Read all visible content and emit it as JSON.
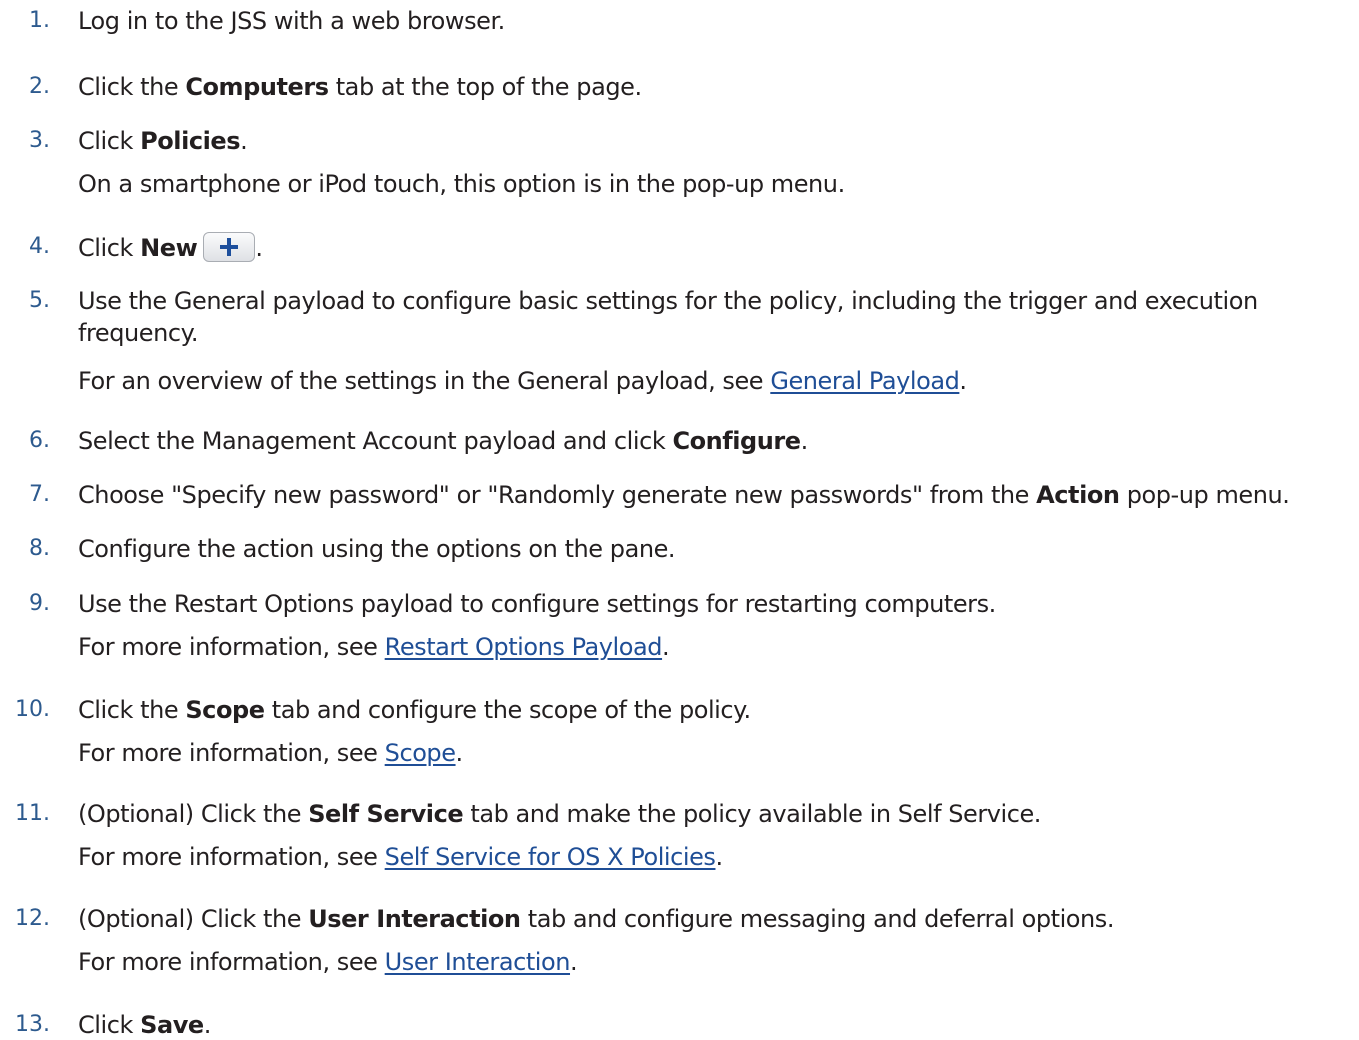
{
  "steps": [
    {
      "num": "1.",
      "a": "Log in to the JSS with a web browser."
    },
    {
      "num": "2.",
      "a": "Click the ",
      "b": "Computers",
      "c": " tab at the top of the page."
    },
    {
      "num": "3.",
      "a": "Click ",
      "b": "Policies",
      "c": ".",
      "note": "On a smartphone or iPod touch, this option is in the pop-up menu."
    },
    {
      "num": "4.",
      "a": "Click ",
      "b": "New",
      "c": ".",
      "button_icon": "plus-icon"
    },
    {
      "num": "5.",
      "a": "Use the General payload to configure basic settings for the policy, including the trigger and execution",
      "a2": "frequency.",
      "note": "For an overview of the settings in the General payload, see ",
      "link": "General Payload",
      "after": "."
    },
    {
      "num": "6.",
      "a": "Select the Management Account payload and click ",
      "b": "Configure",
      "c": "."
    },
    {
      "num": "7.",
      "a": "Choose \"Specify new password\" or \"Randomly generate new passwords\" from the ",
      "b": "Action",
      "c": " pop-up menu."
    },
    {
      "num": "8.",
      "a": "Configure the action using the options on the pane."
    },
    {
      "num": "9.",
      "a": "Use the Restart Options payload to configure settings for restarting computers.",
      "note": "For more information, see ",
      "link": "Restart Options Payload",
      "after": "."
    },
    {
      "num": "10.",
      "a": "Click the ",
      "b": "Scope",
      "c": " tab and configure the scope of the policy.",
      "note": "For more information, see ",
      "link": "Scope",
      "after": "."
    },
    {
      "num": "11.",
      "a": "(Optional) Click the ",
      "b": "Self Service",
      "c": " tab and make the policy available in Self Service.",
      "note": "For more information, see ",
      "link": "Self Service for OS X Policies",
      "after": "."
    },
    {
      "num": "12.",
      "a": "(Optional) Click the ",
      "b": "User Interaction",
      "c": " tab and configure messaging and deferral options.",
      "note": "For more information, see ",
      "link": "User Interaction",
      "after": "."
    },
    {
      "num": "13.",
      "a": "Click ",
      "b": "Save",
      "c": "."
    }
  ],
  "colors": {
    "text": "#231f20",
    "number": "#2d5a8e",
    "link": "#1f4e96",
    "button_plus": "#1d4f9c"
  }
}
